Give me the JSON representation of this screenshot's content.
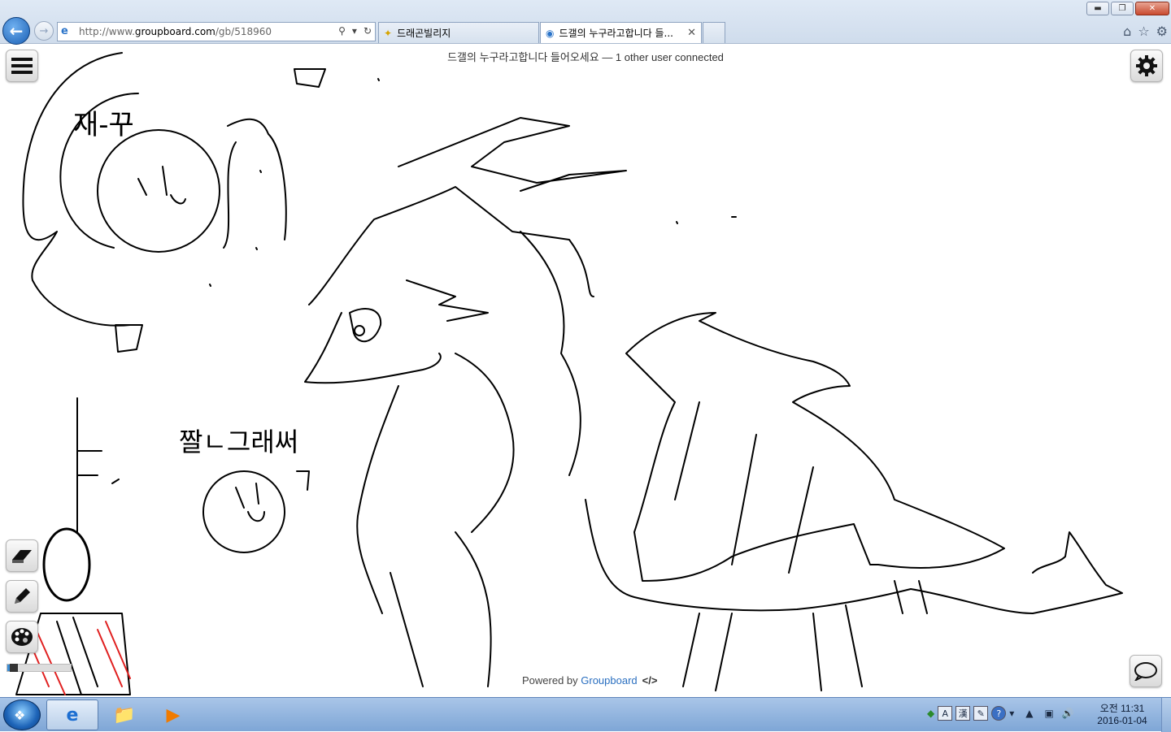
{
  "browser": {
    "url_prefix": "http://www.",
    "url_host": "groupboard.com",
    "url_path": "/gb/518960",
    "tabs": [
      {
        "label": "드래곤빌리지",
        "active": false
      },
      {
        "label": "드갤의 누구라고합니다 들...",
        "active": true
      }
    ],
    "window_buttons": {
      "minimize": "▬",
      "restore": "❐",
      "close": "✕"
    }
  },
  "board": {
    "status_text": "드갤의 누구라고합니다 들어오세요 — 1 other user connected",
    "powered_by_prefix": "Powered by ",
    "powered_by_link": "Groupboard",
    "embed_icon": "</>",
    "drawing_texts": {
      "top_label": "재-꾸",
      "middle_label": "짤ㄴ그래써",
      "face_label_1": "ㅁ",
      "face_label_2": "ㄴ",
      "side_note": "ㅁ"
    },
    "tools": {
      "menu": "hamburger-menu-icon",
      "settings": "gear-icon",
      "eraser": "eraser-icon",
      "pencil": "pencil-icon",
      "palette": "palette-icon",
      "chat": "chat-bubble-icon"
    },
    "brush_size": 0.15
  },
  "taskbar": {
    "clock_period": "오전 11:31",
    "clock_date": "2016-01-04",
    "tray_items": [
      "A",
      "漢",
      "?"
    ]
  },
  "colors": {
    "accent_blue": "#2a6fc0",
    "stroke": "#000000",
    "red_stroke": "#e02020"
  }
}
